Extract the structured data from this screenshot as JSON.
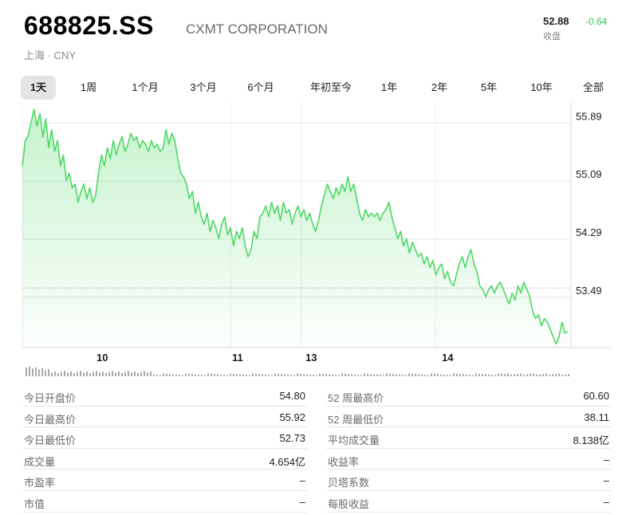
{
  "header": {
    "ticker": "688825.SS",
    "company": "CXMT CORPORATION",
    "exchange": "上海 · CNY",
    "price": "52.88",
    "change": "-0.64",
    "close_label": "收盘"
  },
  "colors": {
    "accent_green": "#34c759",
    "line_green": "#4cd964",
    "active_tab": "#e4e4e6"
  },
  "ranges": [
    {
      "label": "1天",
      "active": true
    },
    {
      "label": "1周",
      "active": false
    },
    {
      "label": "1个月",
      "active": false
    },
    {
      "label": "3个月",
      "active": false
    },
    {
      "label": "6个月",
      "active": false
    },
    {
      "label": "年初至今",
      "active": false
    },
    {
      "label": "1年",
      "active": false
    },
    {
      "label": "2年",
      "active": false
    },
    {
      "label": "5年",
      "active": false
    },
    {
      "label": "10年",
      "active": false
    },
    {
      "label": "全部",
      "active": false
    }
  ],
  "chart_data": {
    "type": "area",
    "x_tick_labels": [
      "10",
      "11",
      "13",
      "14"
    ],
    "y_tick_labels": [
      "55.89",
      "55.09",
      "54.29",
      "53.49"
    ],
    "y_ticks": [
      55.89,
      55.09,
      54.29,
      53.49
    ],
    "ylim": [
      52.7,
      56.08
    ],
    "previous_close": 53.52,
    "grid": true,
    "values": [
      55.2,
      55.55,
      55.62,
      55.8,
      55.98,
      55.75,
      55.92,
      55.6,
      55.85,
      55.45,
      55.7,
      55.4,
      55.55,
      55.2,
      55.35,
      55.0,
      55.1,
      54.9,
      54.95,
      54.7,
      54.85,
      54.95,
      54.75,
      54.9,
      54.7,
      54.8,
      55.1,
      55.35,
      55.2,
      55.45,
      55.3,
      55.55,
      55.35,
      55.5,
      55.6,
      55.4,
      55.5,
      55.65,
      55.55,
      55.6,
      55.45,
      55.55,
      55.5,
      55.4,
      55.55,
      55.45,
      55.5,
      55.4,
      55.45,
      55.7,
      55.5,
      55.65,
      55.55,
      55.3,
      55.1,
      55.05,
      54.95,
      54.75,
      54.85,
      54.55,
      54.7,
      54.5,
      54.4,
      54.55,
      54.3,
      54.45,
      54.35,
      54.2,
      54.4,
      54.5,
      54.25,
      54.35,
      54.1,
      54.3,
      54.2,
      54.35,
      54.1,
      53.95,
      54.05,
      54.3,
      54.2,
      54.5,
      54.55,
      54.65,
      54.5,
      54.7,
      54.55,
      54.65,
      54.45,
      54.7,
      54.55,
      54.6,
      54.4,
      54.55,
      54.65,
      54.5,
      54.6,
      54.45,
      54.55,
      54.4,
      54.3,
      54.45,
      54.65,
      54.8,
      54.95,
      54.85,
      54.75,
      54.9,
      54.8,
      54.95,
      54.85,
      55.05,
      54.85,
      54.95,
      54.75,
      54.55,
      54.45,
      54.6,
      54.5,
      54.55,
      54.5,
      54.55,
      54.45,
      54.55,
      54.6,
      54.7,
      54.5,
      54.35,
      54.2,
      54.3,
      54.1,
      54.2,
      54.0,
      54.15,
      54.05,
      53.95,
      54.0,
      53.85,
      53.95,
      53.8,
      53.9,
      53.7,
      53.8,
      53.85,
      53.65,
      53.75,
      53.6,
      53.55,
      53.7,
      53.85,
      53.95,
      53.8,
      53.95,
      54.05,
      53.85,
      53.75,
      53.55,
      53.5,
      53.4,
      53.5,
      53.55,
      53.45,
      53.55,
      53.6,
      53.5,
      53.4,
      53.3,
      53.45,
      53.35,
      53.55,
      53.45,
      53.6,
      53.5,
      53.4,
      53.2,
      53.1,
      53.15,
      53.0,
      53.1,
      53.05,
      52.95,
      52.85,
      52.75,
      52.85,
      53.05,
      52.9,
      52.92
    ]
  },
  "stats": {
    "left": [
      {
        "label": "今日开盘价",
        "value": "54.80"
      },
      {
        "label": "今日最高价",
        "value": "55.92"
      },
      {
        "label": "今日最低价",
        "value": "52.73"
      },
      {
        "label": "成交量",
        "value": "4.654亿"
      },
      {
        "label": "市盈率",
        "value": "–"
      },
      {
        "label": "市值",
        "value": "–"
      }
    ],
    "right": [
      {
        "label": "52 周最高价",
        "value": "60.60"
      },
      {
        "label": "52 周最低价",
        "value": "38.11"
      },
      {
        "label": "平均成交量",
        "value": "8.138亿"
      },
      {
        "label": "收益率",
        "value": "–"
      },
      {
        "label": "贝塔系数",
        "value": "–"
      },
      {
        "label": "每股收益",
        "value": "–"
      }
    ]
  }
}
